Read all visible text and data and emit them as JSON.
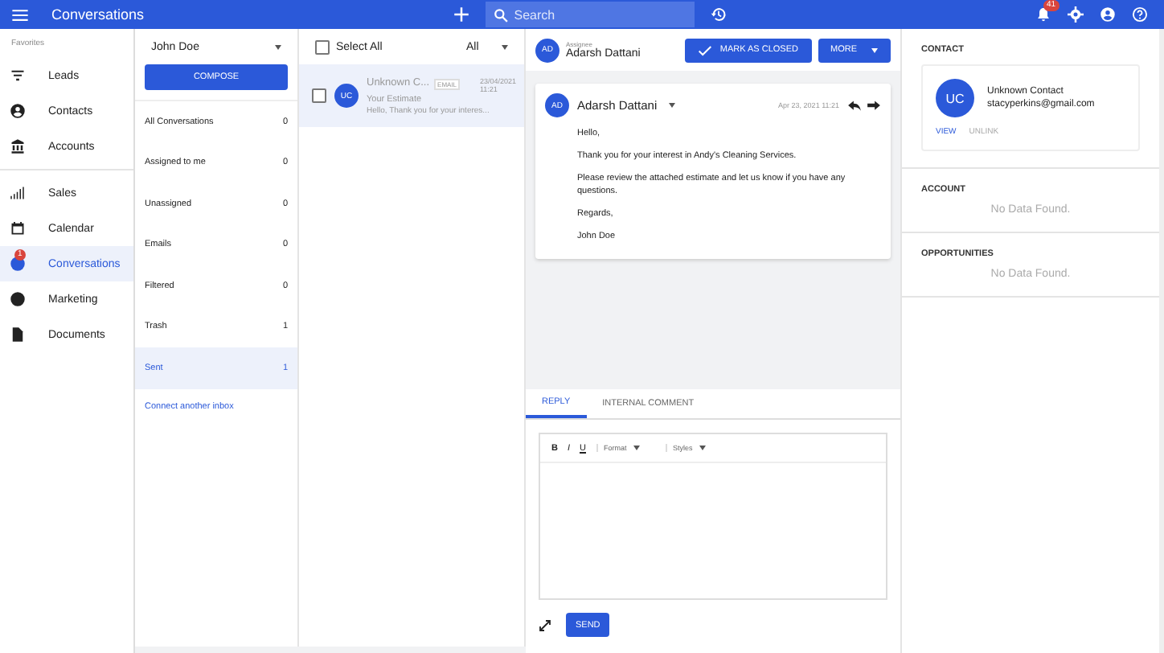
{
  "topbar": {
    "title": "Conversations",
    "search": {
      "placeholder": "Search"
    },
    "notification_count": "41"
  },
  "sidebar": {
    "section": "Favorites",
    "items": [
      {
        "label": "Leads",
        "selected": false
      },
      {
        "label": "Contacts",
        "selected": false
      },
      {
        "label": "Accounts",
        "selected": false
      },
      {
        "label": "Sales",
        "selected": false
      },
      {
        "label": "Calendar",
        "selected": false
      },
      {
        "label": "Conversations",
        "selected": true,
        "badge": "1"
      },
      {
        "label": "Marketing",
        "selected": false
      },
      {
        "label": "Documents",
        "selected": false
      }
    ]
  },
  "folders": {
    "user": "John Doe",
    "compose": "COMPOSE",
    "items": [
      {
        "label": "All Conversations",
        "count": "0",
        "selected": false
      },
      {
        "label": "Assigned to me",
        "count": "0",
        "selected": false
      },
      {
        "label": "Unassigned",
        "count": "0",
        "selected": false
      },
      {
        "label": "Emails",
        "count": "0",
        "selected": false
      },
      {
        "label": "Filtered",
        "count": "0",
        "selected": false
      },
      {
        "label": "Trash",
        "count": "1",
        "selected": false
      },
      {
        "label": "Sent",
        "count": "1",
        "selected": true
      }
    ],
    "connect_link": "Connect another inbox"
  },
  "list": {
    "select_all": "Select All",
    "select_all_checked": false,
    "filter": "All",
    "items": [
      {
        "initials": "UC",
        "name": "Unknown C...",
        "channel": "EMAIL",
        "date": "23/04/2021",
        "time": "11:21",
        "subject": "Your Estimate",
        "preview": "Hello, Thank you for your interes...",
        "checked": false,
        "selected": true
      }
    ]
  },
  "detail": {
    "assignee_initials": "AD",
    "assignee_label": "Assignee",
    "assignee": "Adarsh Dattani",
    "mark_closed": "MARK AS CLOSED",
    "more": "MORE",
    "message": {
      "initials": "AD",
      "sender": "Adarsh Dattani",
      "date": "Apr 23, 2021 11:21",
      "paragraphs": [
        "Hello,",
        "Thank you for your interest in Andy's Cleaning Services.",
        "Please review the attached estimate and let us know if you have any questions.",
        "Regards,",
        "John Doe"
      ]
    },
    "tabs": [
      {
        "label": "REPLY",
        "selected": true
      },
      {
        "label": "INTERNAL COMMENT",
        "selected": false
      }
    ],
    "toolbar": {
      "bold": "B",
      "italic": "I",
      "underline": "U",
      "format": "Format",
      "styles": "Styles"
    },
    "send": "SEND"
  },
  "right": {
    "contact": {
      "heading": "CONTACT",
      "initials": "UC",
      "name": "Unknown Contact",
      "email": "stacyperkins@gmail.com",
      "view": "VIEW",
      "unlink": "UNLINK"
    },
    "sections": [
      {
        "heading": "ACCOUNT",
        "empty": "No Data Found."
      },
      {
        "heading": "OPPORTUNITIES",
        "empty": "No Data Found."
      }
    ]
  }
}
